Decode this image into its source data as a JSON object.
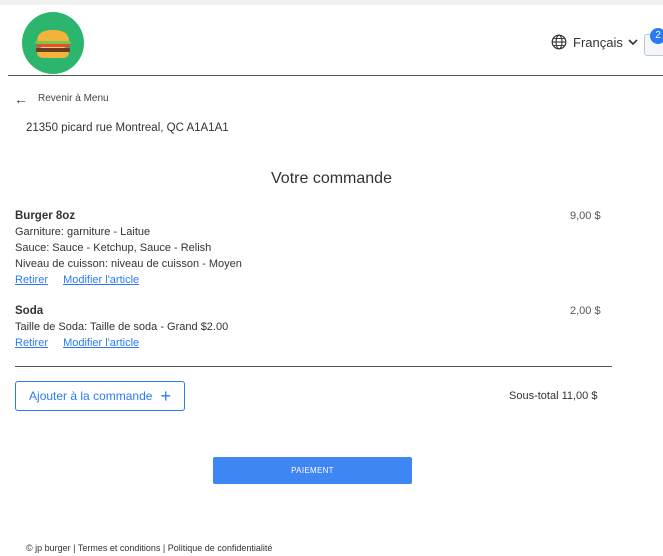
{
  "header": {
    "logo_name": "burger-logo",
    "language": "Français",
    "cart_count": "2"
  },
  "nav": {
    "back_label": "Revenir à Menu",
    "address": "21350 picard rue Montreal, QC A1A1A1"
  },
  "order": {
    "title": "Votre commande",
    "items": [
      {
        "name": "Burger 8oz",
        "price": "9,00 $",
        "options": [
          "Garniture: garniture - Laitue",
          "Sauce: Sauce - Ketchup, Sauce  - Relish",
          "Niveau de cuisson: niveau de cuisson - Moyen"
        ],
        "remove_label": "Retirer",
        "edit_label": "Modifier l'article"
      },
      {
        "name": "Soda",
        "price": "2,00 $",
        "options": [
          "Taille de Soda: Taille de soda - Grand $2.00"
        ],
        "remove_label": "Retirer",
        "edit_label": "Modifier l'article"
      }
    ],
    "add_label": "Ajouter à la commande",
    "subtotal": "Sous-total 11,00 $",
    "pay_label": "PAIEMENT"
  },
  "footer": {
    "copyright": "© jp burger",
    "separator": "|",
    "terms": "Termes et conditions",
    "privacy": "Politique de confidentialité"
  },
  "colors": {
    "accent": "#2a7bf3",
    "pay_button": "#3f86f5",
    "logo_bg": "#2cb56d"
  }
}
